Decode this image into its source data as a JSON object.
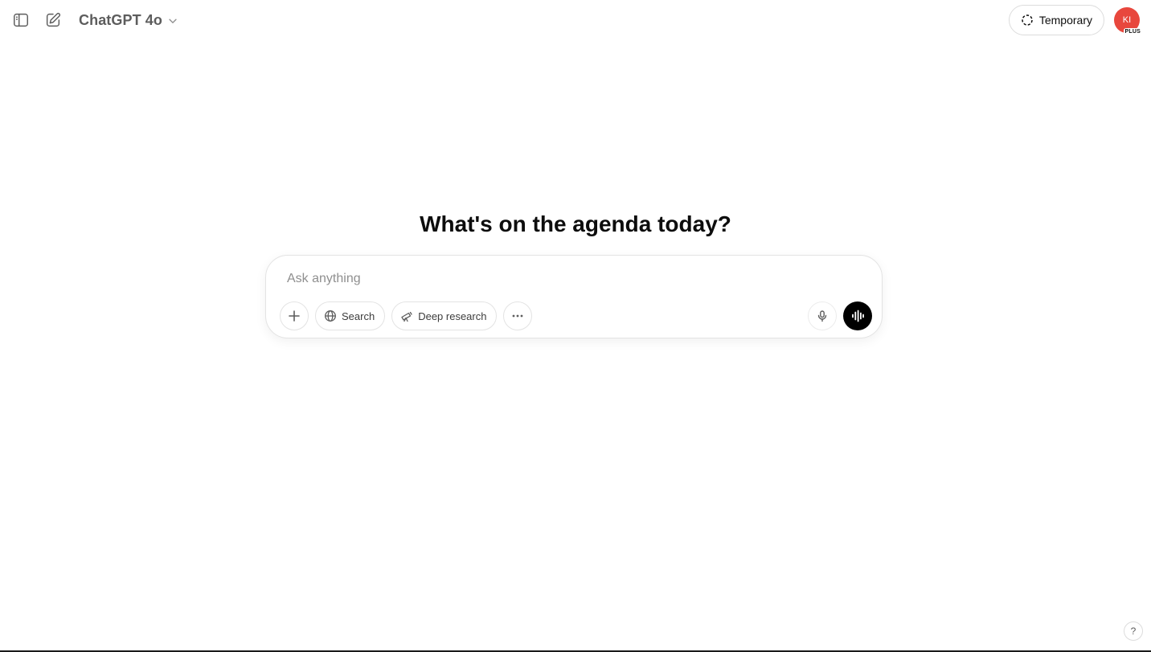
{
  "header": {
    "model_name": "ChatGPT 4o",
    "temporary_label": "Temporary",
    "avatar_initials": "KI",
    "avatar_badge": "PLUS",
    "avatar_color": "#e8473d"
  },
  "main": {
    "headline": "What's on the agenda today?"
  },
  "composer": {
    "placeholder": "Ask anything",
    "value": "",
    "tools": {
      "search_label": "Search",
      "deep_research_label": "Deep research"
    }
  },
  "help": {
    "label": "?"
  },
  "icons": {
    "sidebar": "sidebar-toggle-icon",
    "compose": "new-chat-icon",
    "model_chevron": "chevron-down-icon",
    "temporary": "dashed-circle-icon",
    "add": "plus-icon",
    "search": "globe-icon",
    "deep_research": "telescope-icon",
    "more": "more-dots-icon",
    "mic": "microphone-icon",
    "voice": "voice-wave-icon"
  }
}
